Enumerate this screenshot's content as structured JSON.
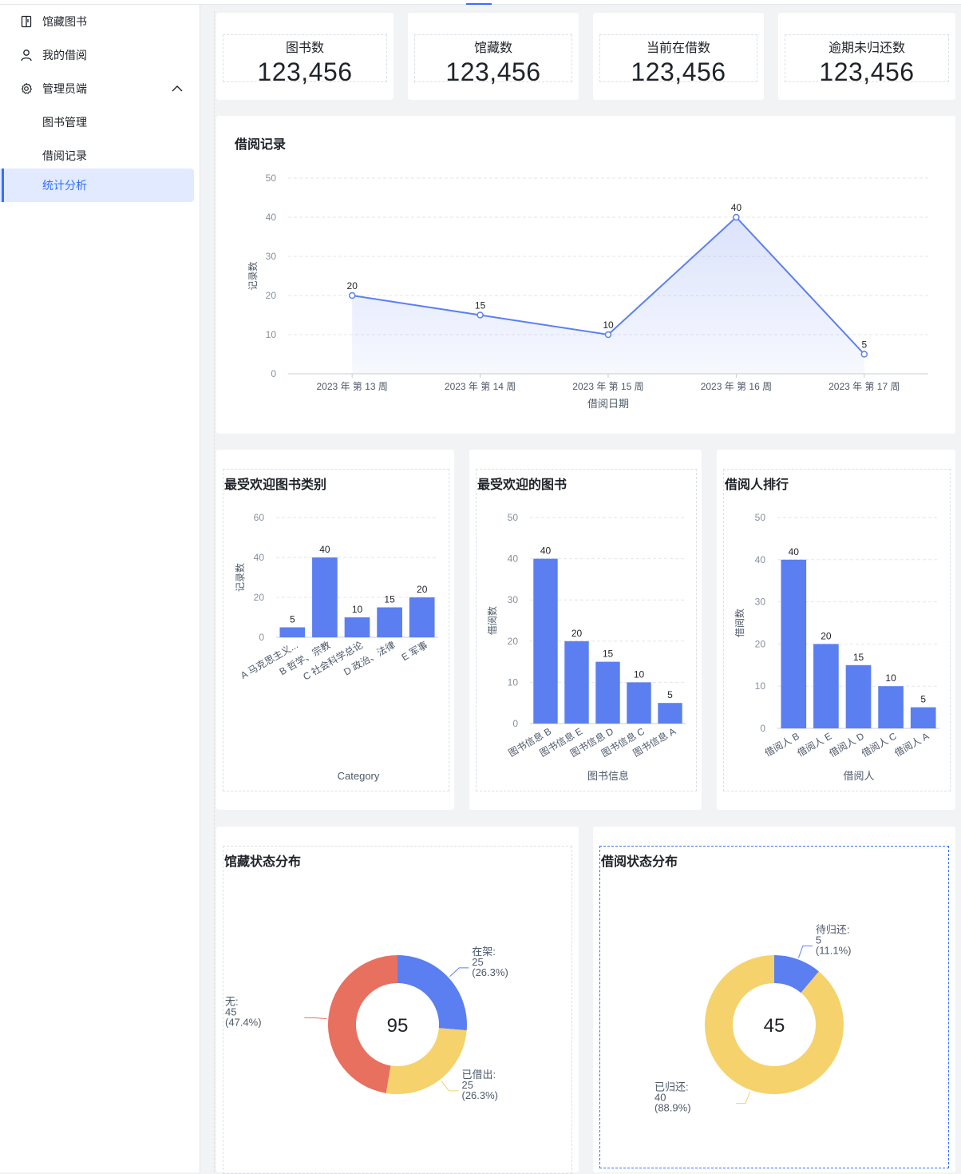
{
  "sidebar": {
    "items": [
      {
        "label": "馆藏图书",
        "icon": "book-icon"
      },
      {
        "label": "我的借阅",
        "icon": "user-icon"
      },
      {
        "label": "管理员端",
        "icon": "gear-icon"
      },
      {
        "label": "图书管理"
      },
      {
        "label": "借阅记录"
      },
      {
        "label": "统计分析"
      }
    ]
  },
  "stats": [
    {
      "title": "图书数",
      "value": "123,456"
    },
    {
      "title": "馆藏数",
      "value": "123,456"
    },
    {
      "title": "当前在借数",
      "value": "123,456"
    },
    {
      "title": "逾期未归还数",
      "value": "123,456"
    }
  ],
  "borrow_chart": {
    "title": "借阅记录",
    "chart_data": {
      "type": "line",
      "categories": [
        "2023 年 第 13 周",
        "2023 年 第 14 周",
        "2023 年 第 15 周",
        "2023 年 第 16 周",
        "2023 年 第 17 周"
      ],
      "values": [
        20,
        15,
        10,
        40,
        5
      ],
      "xlabel": "借阅日期",
      "ylabel": "记录数",
      "ylim": [
        0,
        50
      ],
      "yticks": [
        0,
        10,
        20,
        30,
        40,
        50
      ],
      "area": true,
      "color": "#5b7ff0"
    }
  },
  "category_chart": {
    "title": "最受欢迎图书类别",
    "chart_data": {
      "type": "bar",
      "categories": [
        "A 马克思主义...",
        "B 哲学、宗教",
        "C 社会科学总论",
        "D 政治、法律",
        "E 军事"
      ],
      "values": [
        5,
        40,
        10,
        15,
        20
      ],
      "xlabel": "Category",
      "ylabel": "记录数",
      "ylim": [
        0,
        60
      ],
      "yticks": [
        0,
        20,
        40,
        60
      ],
      "color": "#5b7ff0"
    }
  },
  "book_chart": {
    "title": "最受欢迎的图书",
    "chart_data": {
      "type": "bar",
      "categories": [
        "图书信息 B",
        "图书信息 E",
        "图书信息 D",
        "图书信息 C",
        "图书信息 A"
      ],
      "values": [
        40,
        20,
        15,
        10,
        5
      ],
      "xlabel": "图书信息",
      "ylabel": "借阅数",
      "ylim": [
        0,
        50
      ],
      "yticks": [
        0,
        10,
        20,
        30,
        40,
        50
      ],
      "color": "#5b7ff0"
    }
  },
  "borrower_chart": {
    "title": "借阅人排行",
    "chart_data": {
      "type": "bar",
      "categories": [
        "借阅人 B",
        "借阅人 E",
        "借阅人 D",
        "借阅人 C",
        "借阅人 A"
      ],
      "values": [
        40,
        20,
        15,
        10,
        5
      ],
      "xlabel": "借阅人",
      "ylabel": "借阅数",
      "ylim": [
        0,
        50
      ],
      "yticks": [
        0,
        10,
        20,
        30,
        40,
        50
      ],
      "color": "#5b7ff0"
    }
  },
  "collection_chart": {
    "title": "馆藏状态分布",
    "chart_data": {
      "type": "pie",
      "total_label": "95",
      "slices": [
        {
          "name": "在架",
          "value": 25,
          "label": "25",
          "percent": "(26.3%)",
          "color": "#5b7ff0"
        },
        {
          "name": "已借出",
          "value": 25,
          "label": "25",
          "percent": "(26.3%)",
          "color": "#f5d26b"
        },
        {
          "name": "无",
          "value": 45,
          "label": "45",
          "percent": "(47.4%)",
          "color": "#e8705f"
        }
      ]
    }
  },
  "status_chart": {
    "title": "借阅状态分布",
    "chart_data": {
      "type": "pie",
      "total_label": "45",
      "slices": [
        {
          "name": "待归还",
          "value": 5,
          "label": "5",
          "percent": "(11.1%)",
          "color": "#5b7ff0"
        },
        {
          "name": "已归还",
          "value": 40,
          "label": "40",
          "percent": "(88.9%)",
          "color": "#f5d26b"
        }
      ]
    }
  }
}
